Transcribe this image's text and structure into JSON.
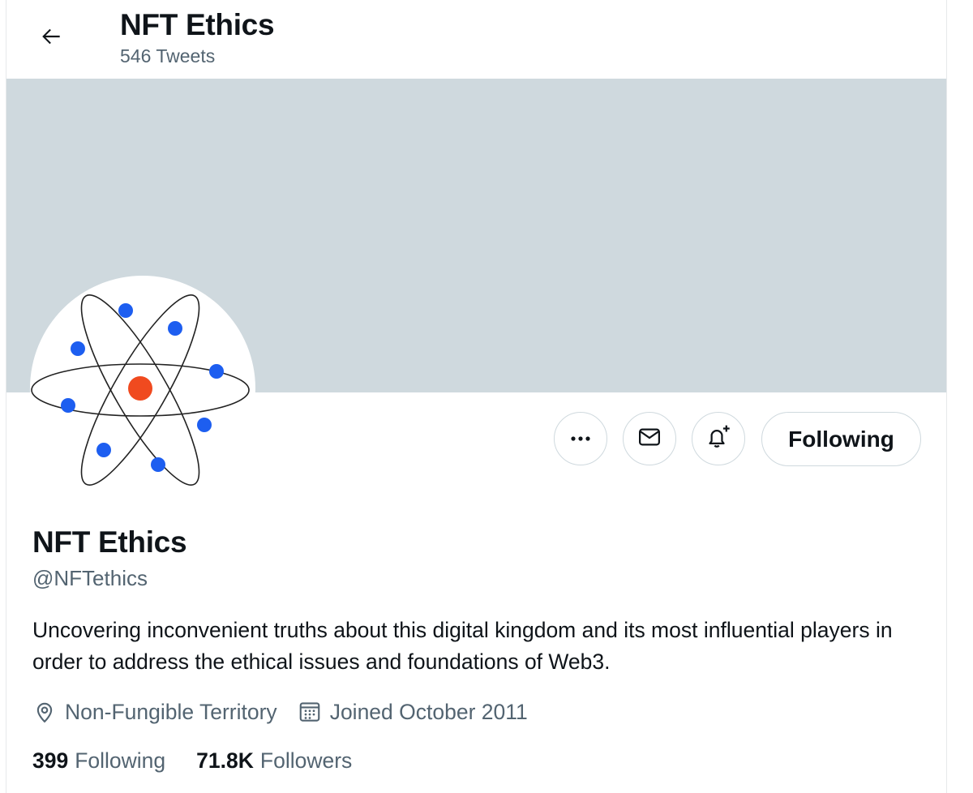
{
  "header": {
    "title": "NFT Ethics",
    "tweet_count": "546 Tweets"
  },
  "colors": {
    "banner": "#cfd9de",
    "electron": "#1d5ef0",
    "nucleus": "#f04a1f",
    "primary_text": "#0f1419",
    "secondary_text": "#536471",
    "button_border": "#cfd9de"
  },
  "actions": {
    "more_icon": "more-horizontal-icon",
    "message_icon": "mail-icon",
    "notify_icon": "bell-plus-icon",
    "follow_label": "Following"
  },
  "profile": {
    "display_name": "NFT Ethics",
    "handle": "@NFTethics",
    "bio": "Uncovering inconvenient truths about this digital kingdom and its most influential players in order to address the ethical issues and foundations of Web3.",
    "location": "Non-Fungible Territory",
    "joined": "Joined October 2011"
  },
  "stats": {
    "following_count": "399",
    "following_label": "Following",
    "followers_count": "71.8K",
    "followers_label": "Followers"
  }
}
